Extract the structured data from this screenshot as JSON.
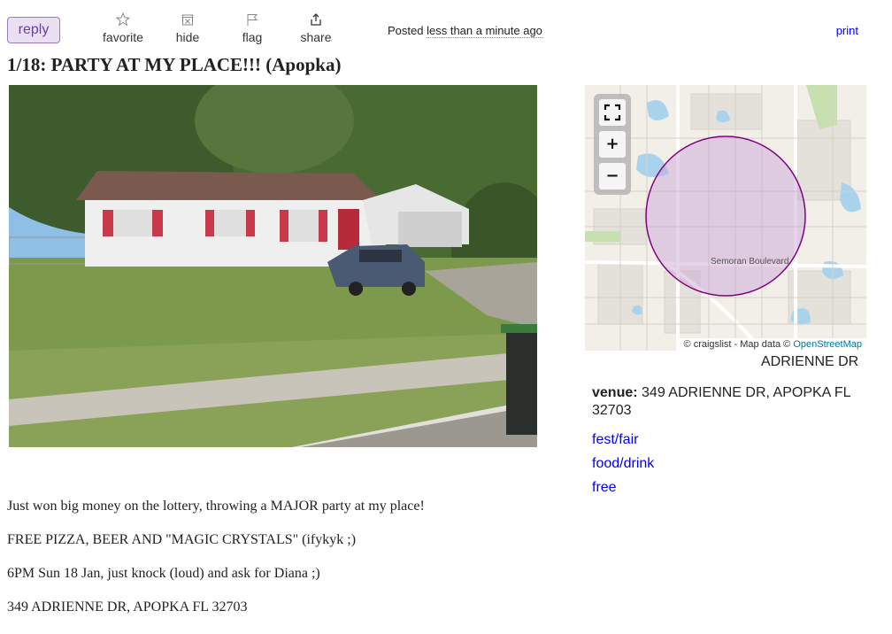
{
  "toolbar": {
    "reply_label": "reply",
    "favorite_label": "favorite",
    "hide_label": "hide",
    "flag_label": "flag",
    "share_label": "share",
    "posted_prefix": "Posted",
    "posted_ago": "less than a minute ago",
    "print_label": "print"
  },
  "post": {
    "title": "1/18: PARTY AT MY PLACE!!! (Apopka)"
  },
  "map": {
    "attribution_prefix": "© craigslist - Map data ©",
    "attribution_link": "OpenStreetMap",
    "road_label": "Semoran Boulevard",
    "fullscreen_icon": "fullscreen-icon",
    "zoom_in_label": "+",
    "zoom_out_label": "−",
    "caption": "ADRIENNE DR",
    "circle_color": "#800080"
  },
  "venue": {
    "label": "venue:",
    "value": "349 ADRIENNE DR, APOPKA FL 32703"
  },
  "tags": [
    "fest/fair",
    "food/drink",
    "free"
  ],
  "body": [
    "Just won big money on the lottery, throwing a MAJOR party at my place!",
    "FREE PIZZA, BEER AND \"MAGIC CRYSTALS\" (ifykyk ;)",
    "6PM Sun 18 Jan, just knock (loud) and ask for Diana ;)",
    "349 ADRIENNE DR, APOPKA FL 32703"
  ],
  "colors": {
    "reply_bg": "#eadff3",
    "reply_border": "#9a7bc1",
    "link": "#0000ee"
  }
}
